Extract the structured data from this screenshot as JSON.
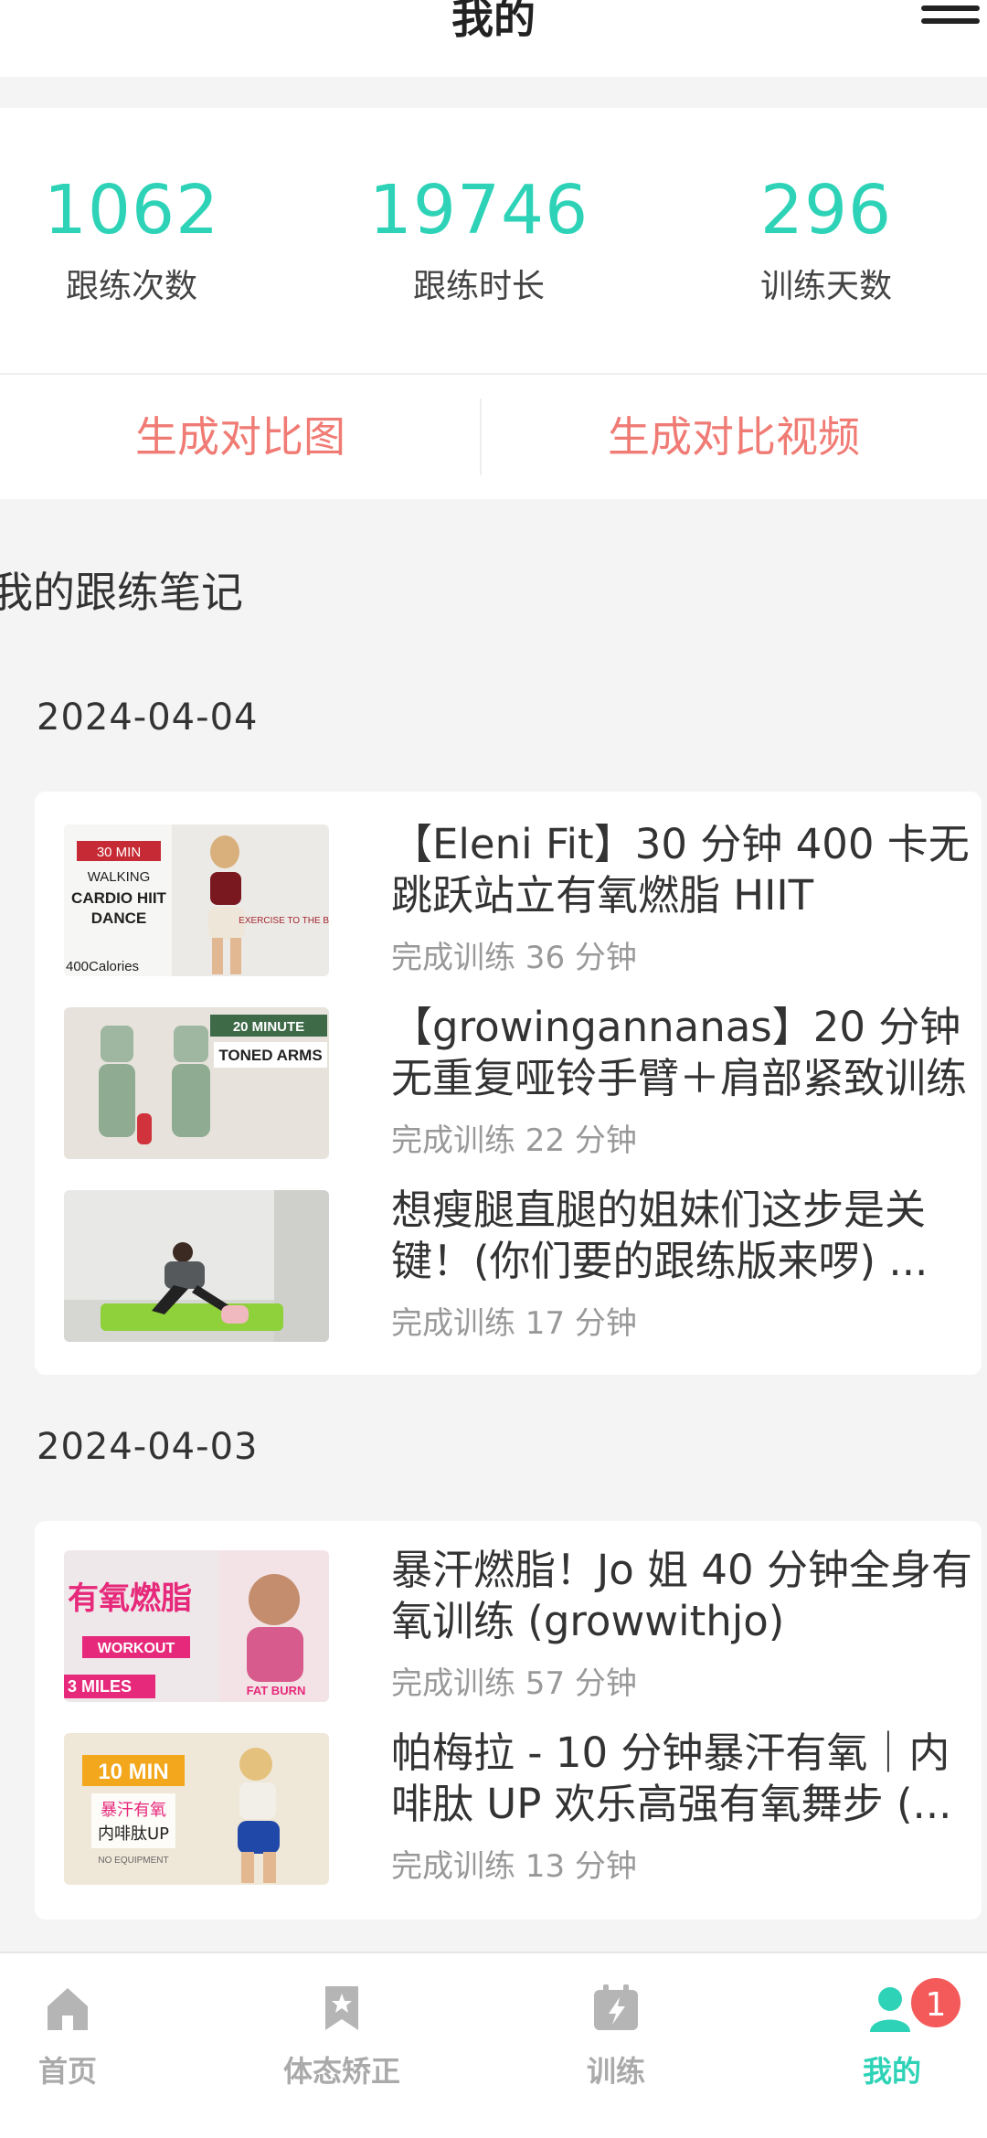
{
  "header": {
    "title": "我的"
  },
  "stats": [
    {
      "value": "1062",
      "label": "跟练次数"
    },
    {
      "value": "19746",
      "label": "跟练时长"
    },
    {
      "value": "296",
      "label": "训练天数"
    }
  ],
  "actions": {
    "compare_image": "生成对比图",
    "compare_video": "生成对比视频"
  },
  "notes": {
    "title": "我的跟练笔记",
    "groups": [
      {
        "date": "2024-04-04",
        "items": [
          {
            "title": "【Eleni Fit】30 分钟 400 卡无跳跃站立有氧燃脂 HIIT",
            "meta": "完成训练 36 分钟",
            "thumb": {
              "line1": "30 MIN",
              "line2": "WALKING",
              "line3": "CARDIO HIIT",
              "line4": "DANCE",
              "line5": "400Calories",
              "line6": "EXERCISE TO THE BEAT"
            }
          },
          {
            "title": "【growingannanas】20 分钟无重复哑铃手臂＋肩部紧致训练",
            "meta": "完成训练 22 分钟",
            "thumb": {
              "line1": "20 MINUTE",
              "line2": "TONED ARMS"
            }
          },
          {
            "title": "想瘦腿直腿的姐妹们这步是关键！(你们要的跟练版来啰) ...",
            "meta": "完成训练 17 分钟",
            "thumb": {}
          }
        ]
      },
      {
        "date": "2024-04-03",
        "items": [
          {
            "title": "暴汗燃脂！Jo 姐 40 分钟全身有氧训练 (growwithjo)",
            "meta": "完成训练 57 分钟",
            "thumb": {
              "line1": "有氧燃脂",
              "line2": "WORKOUT",
              "line3": "3 MILES",
              "line4": "FAT BURN"
            }
          },
          {
            "title": "帕梅拉 - 10 分钟暴汗有氧｜内啡肽 UP 欢乐高强有氧舞步 (...",
            "meta": "完成训练 13 分钟",
            "thumb": {
              "line1": "10 MIN",
              "line2": "暴汗有氧",
              "line3": "内啡肽UP",
              "line4": "NO EQUIPMENT"
            }
          }
        ]
      }
    ]
  },
  "nav": {
    "items": [
      {
        "label": "首页",
        "icon": "home-icon"
      },
      {
        "label": "体态矫正",
        "icon": "bookmark-icon"
      },
      {
        "label": "训练",
        "icon": "training-icon"
      },
      {
        "label": "我的",
        "icon": "profile-icon",
        "badge": "1"
      }
    ],
    "active_color": "#2ed3b7"
  },
  "colors": {
    "accent": "#2ed3b7",
    "action": "#f07b74",
    "badge": "#f45a5a"
  }
}
